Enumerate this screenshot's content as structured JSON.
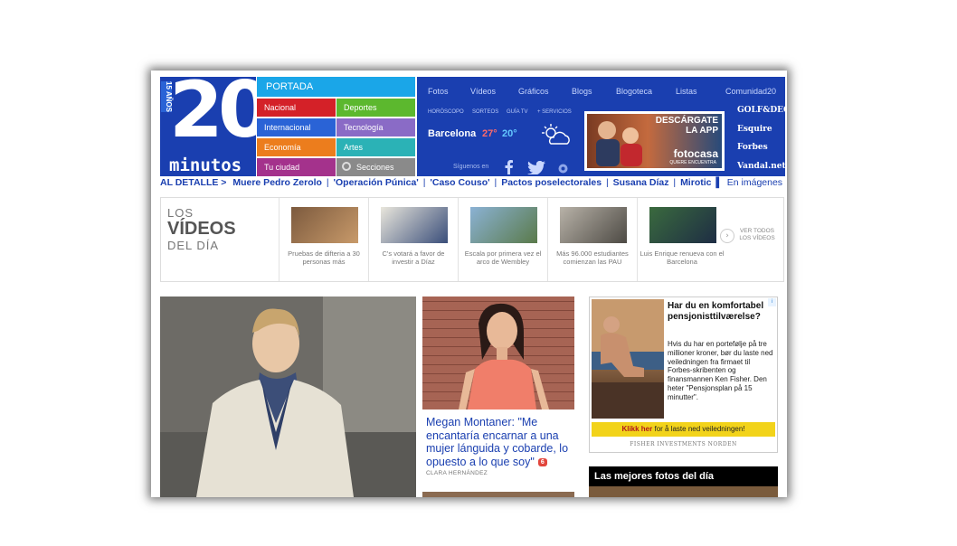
{
  "logo": {
    "number": "20",
    "word": "minutos",
    "anniversary": "15 AÑOS"
  },
  "sections": {
    "portada": "PORTADA",
    "items": [
      {
        "label": "Nacional",
        "color": "#d42128"
      },
      {
        "label": "Deportes",
        "color": "#5cb82e"
      },
      {
        "label": "Internacional",
        "color": "#2a63d6"
      },
      {
        "label": "Tecnología",
        "color": "#8a6bc6"
      },
      {
        "label": "Economía",
        "color": "#ec7d1d"
      },
      {
        "label": "Artes",
        "color": "#2bb2b6"
      },
      {
        "label": "Tu ciudad",
        "color": "#a4328c"
      },
      {
        "label": "Secciones",
        "color": "#8a8a8a"
      }
    ]
  },
  "topnav": [
    "Fotos",
    "Vídeos",
    "Gráficos",
    "Blogs",
    "Blogoteca",
    "Listas",
    "Comunidad20"
  ],
  "subnav": [
    "HORÓSCOPO",
    "SORTEOS",
    "GUÍA TV",
    "+ SERVICIOS"
  ],
  "weather": {
    "city": "Barcelona",
    "max": "27°",
    "min": "20°"
  },
  "social": {
    "label": "Síguenos en"
  },
  "header_ad": {
    "line1": "DESCÁRGATE",
    "line2": "LA APP",
    "brand": "fotocasa",
    "tagline": "QUIERE ENCUENTRA"
  },
  "partners": [
    "GOLF&DEO",
    "Esquire",
    "Forbes",
    "Vandal.net"
  ],
  "breaking": {
    "lead": "AL DETALLE >",
    "items": [
      "Muere Pedro Zerolo",
      "'Operación Púnica'",
      "'Caso Couso'",
      "Pactos poselectorales",
      "Susana Díaz",
      "Mirotic"
    ],
    "last": "En imágenes"
  },
  "videos": {
    "title1": "LOS",
    "title2": "VÍDEOS",
    "title3": "DEL DÍA",
    "items": [
      {
        "caption": "Pruebas de difteria a 30 personas más"
      },
      {
        "caption": "C's votará a favor de investir a Díaz"
      },
      {
        "caption": "Escala por primera vez el arco de Wembley"
      },
      {
        "caption": "Más 96.000 estudiantes comienzan las PAU"
      },
      {
        "caption": "Luis Enrique renueva con el Barcelona"
      }
    ],
    "more": "VER TODOS LOS VÍDEOS"
  },
  "story": {
    "headline": "Megan Montaner: \"Me encantaría encarnar a una mujer lánguida y cobarde, lo opuesto a lo que soy\"",
    "comments": "6",
    "byline": "CLARA HERNÁNDEZ"
  },
  "side_ad": {
    "title": "Har du en komfortabel pensjonisttilværelse?",
    "body": "Hvis du har en portefølje på tre millioner kroner, bør du laste ned veiledningen fra firmaet til Forbes-skribenten og finansmannen Ken Fisher. Den heter \"Pensjonsplan på 15 minutter\".",
    "cta_bold": "Klikk her",
    "cta_rest": "for å laste ned veiledningen!",
    "footer": "FISHER INVESTMENTS NORDEN"
  },
  "best_photos": "Las mejores fotos del día"
}
